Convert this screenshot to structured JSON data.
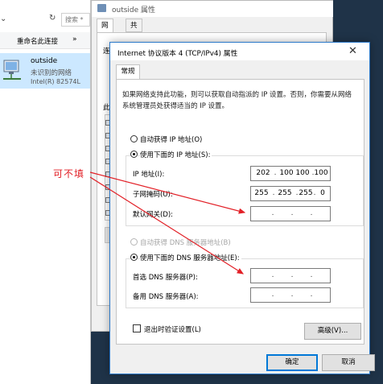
{
  "network_window": {
    "refresh_glyph": "↻",
    "search_placeholder": "搜索 *",
    "rename_label": "重命名此连接",
    "more_glyph": "»",
    "adapter": {
      "name": "outside",
      "status": "未识别的网络",
      "device": "Intel(R) 82574L"
    }
  },
  "annotation": {
    "text": "可不填",
    "color": "#e21f26"
  },
  "props_window": {
    "title": "outside 属性",
    "tab_network": "网络",
    "tab_share": "共享",
    "label_connect": "连",
    "label_items": "此"
  },
  "ipv4_dialog": {
    "title": "Internet 协议版本 4 (TCP/IPv4) 属性",
    "close_glyph": "✕",
    "tab_general": "常规",
    "intro": "如果网络支持此功能，则可以获取自动指派的 IP 设置。否则，你需要从网络系统管理员处获得适当的 IP 设置。",
    "auto_ip": "自动获得 IP 地址(O)",
    "manual_ip": "使用下面的 IP 地址(S):",
    "ip_label": "IP 地址(I):",
    "mask_label": "子网掩码(U):",
    "gateway_label": "默认网关(D):",
    "ip_octets": [
      "202",
      "100",
      "100",
      "100"
    ],
    "mask_octets": [
      "255",
      "255",
      "255",
      "0"
    ],
    "auto_dns": "自动获得 DNS 服务器地址(B)",
    "manual_dns": "使用下面的 DNS 服务器地址(E):",
    "dns1_label": "首选 DNS 服务器(P):",
    "dns2_label": "备用 DNS 服务器(A):",
    "dot": ".",
    "validate_label": "退出时验证设置(L)",
    "advanced_label": "高级(V)...",
    "ok_label": "确定",
    "cancel_label": "取消"
  }
}
